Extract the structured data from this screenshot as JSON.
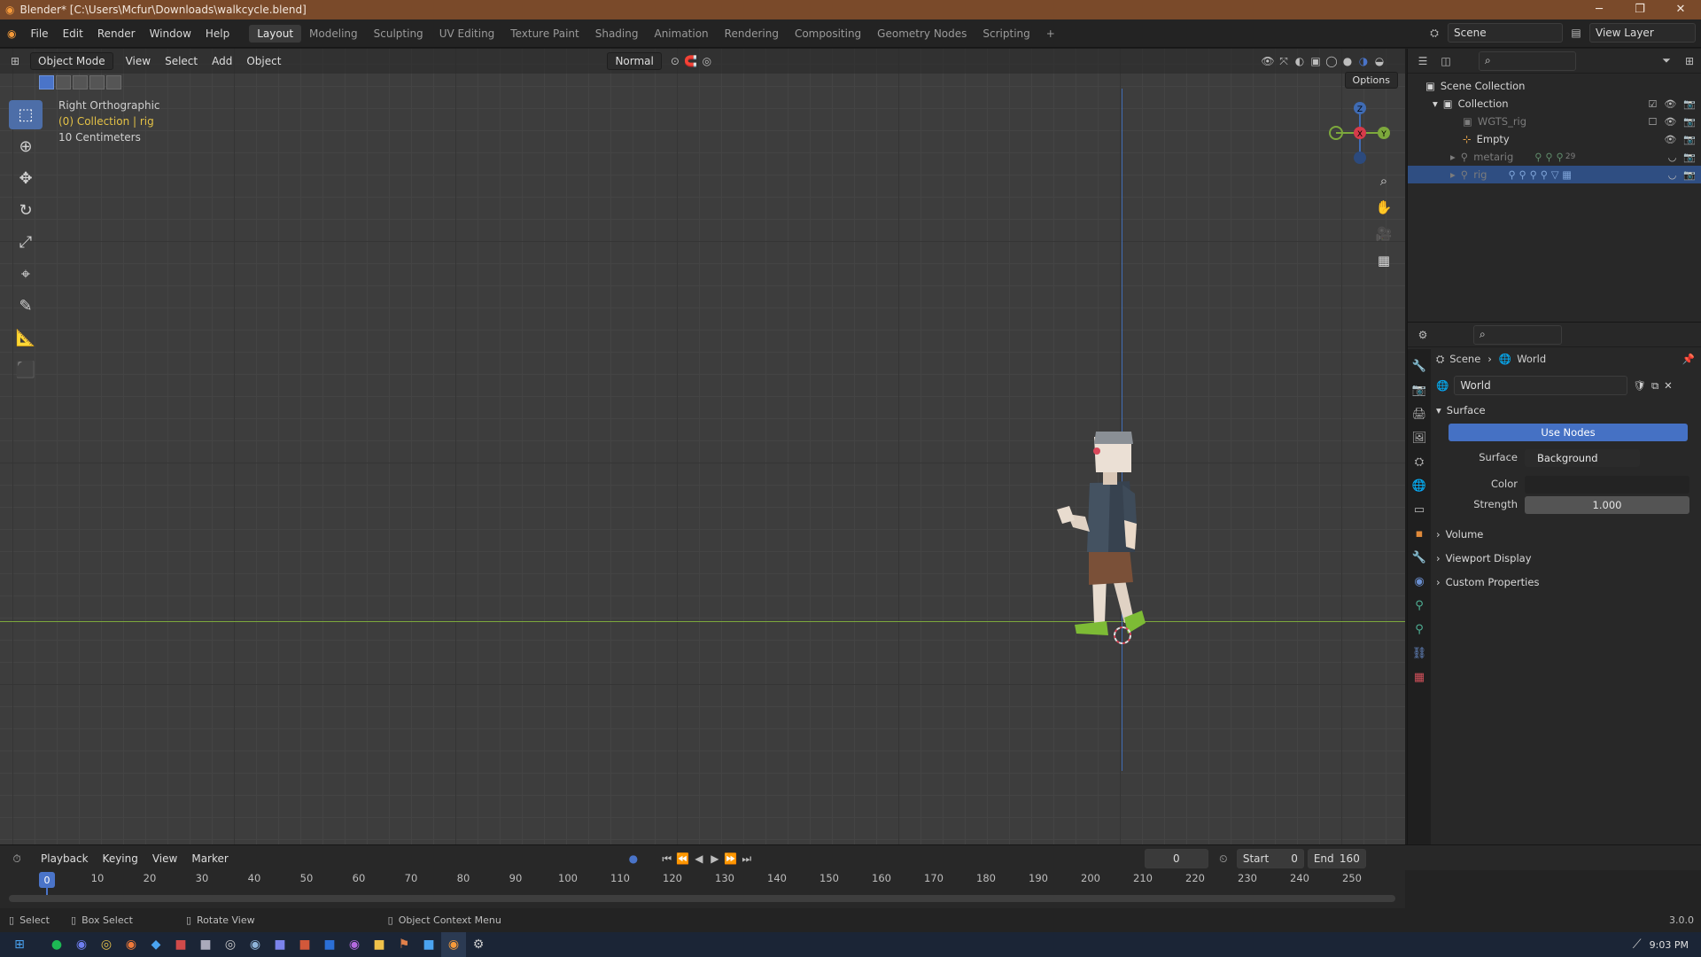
{
  "titlebar": {
    "title": "Blender* [C:\\Users\\Mcfur\\Downloads\\walkcycle.blend]",
    "minimize": "─",
    "restore": "❐",
    "close": "✕"
  },
  "menu": {
    "items": [
      "File",
      "Edit",
      "Render",
      "Window",
      "Help"
    ]
  },
  "workspaces": [
    "Layout",
    "Modeling",
    "Sculpting",
    "UV Editing",
    "Texture Paint",
    "Shading",
    "Animation",
    "Rendering",
    "Compositing",
    "Geometry Nodes",
    "Scripting"
  ],
  "workspace_add": "+",
  "top_right": {
    "scene": "Scene",
    "view_layer": "View Layer"
  },
  "viewport": {
    "mode": "Object Mode",
    "menus": [
      "View",
      "Select",
      "Add",
      "Object"
    ],
    "orientation": "Normal",
    "options": "Options",
    "view_name": "Right Orthographic",
    "collection_info": "(0) Collection | rig",
    "scale": "10 Centimeters",
    "gizmo_labels": {
      "z": "Z",
      "x": "X",
      "y": "Y"
    }
  },
  "outliner": {
    "scene_collection": "Scene Collection",
    "collection": "Collection",
    "items": [
      "WGTS_rig",
      "Empty",
      "metarig",
      "rig"
    ],
    "metarig_count": "29"
  },
  "properties": {
    "breadcrumb_scene": "Scene",
    "breadcrumb_world": "World",
    "world_name": "World",
    "surface_panel": "Surface",
    "use_nodes": "Use Nodes",
    "surface_label": "Surface",
    "surface_value": "Background",
    "color_label": "Color",
    "strength_label": "Strength",
    "strength_value": "1.000",
    "panels": [
      "Volume",
      "Viewport Display",
      "Custom Properties"
    ]
  },
  "timeline": {
    "menus": [
      "Playback",
      "Keying",
      "View",
      "Marker"
    ],
    "current_frame": "0",
    "start_label": "Start",
    "start_value": "0",
    "end_label": "End",
    "end_value": "160",
    "ticks": [
      "10",
      "20",
      "30",
      "40",
      "50",
      "60",
      "70",
      "80",
      "90",
      "100",
      "110",
      "120",
      "130",
      "140",
      "150",
      "160",
      "170",
      "180",
      "190",
      "200",
      "210",
      "220",
      "230",
      "240",
      "250"
    ],
    "playhead": "0"
  },
  "statusbar": {
    "select": "Select",
    "box_select": "Box Select",
    "rotate_view": "Rotate View",
    "context_menu": "Object Context Menu",
    "version": "3.0.0"
  },
  "taskbar": {
    "time": "9:03 PM"
  }
}
